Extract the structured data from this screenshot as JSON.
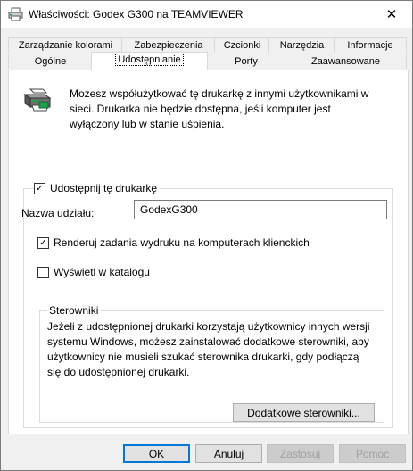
{
  "window": {
    "title": "Właściwości: Godex G300 na TEAMVIEWER",
    "close_glyph": "✕",
    "icon": "printer-icon"
  },
  "tabs": {
    "row1": [
      "Zarządzanie kolorami",
      "Zabezpieczenia",
      "Czcionki",
      "Narzędzia",
      "Informacje"
    ],
    "row2": [
      "Ogólne",
      "Udostępnianie",
      "Porty",
      "Zaawansowane"
    ],
    "active": "Udostępnianie"
  },
  "sharing": {
    "description": "Możesz współużytkować tę drukarkę z innymi użytkownikami w sieci. Drukarka nie będzie dostępna, jeśli komputer jest wyłączony lub w stanie uśpienia.",
    "share_checkbox_label": "Udostępnij tę drukarkę",
    "share_checked": true,
    "share_name_label": "Nazwa udziału:",
    "share_name_value": "GodexG300",
    "render_checkbox_label": "Renderuj zadania wydruku na komputerach klienckich",
    "render_checked": true,
    "list_checkbox_label": "Wyświetl w katalogu",
    "list_checked": false
  },
  "drivers": {
    "title": "Sterowniki",
    "text": "Jeżeli z udostępnionej drukarki korzystają użytkownicy innych wersji systemu Windows, możesz zainstalować dodatkowe sterowniki, aby użytkownicy nie musieli szukać sterownika drukarki, gdy podłączą się do udostępnionej drukarki.",
    "button_label": "Dodatkowe sterowniki..."
  },
  "buttons": {
    "ok": "OK",
    "cancel": "Anuluj",
    "apply": "Zastosuj",
    "help": "Pomoc"
  },
  "colors": {
    "accent": "#0078d7",
    "printer_green": "#1e9e4a"
  }
}
